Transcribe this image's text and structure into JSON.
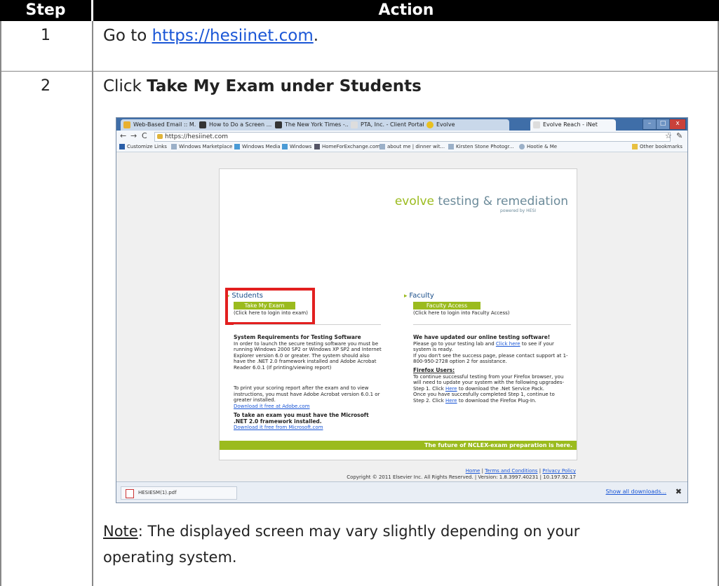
{
  "table": {
    "header_step": "Step",
    "header_action": "Action",
    "rows": [
      {
        "step": "1",
        "text_prefix": "Go to ",
        "link": "https://hesiinet.com",
        "text_suffix": "."
      },
      {
        "step": "2",
        "text_prefix": "Click ",
        "bold": "Take My Exam under Students"
      }
    ],
    "note_label": "Note",
    "note_text": ":  The displayed screen may vary slightly depending on your operating system."
  },
  "browser": {
    "tabs": [
      "Web-Based Email :: M...",
      "How to Do a Screen ...",
      "The New York Times -...",
      "PTA, Inc. - Client Portal",
      "Evolve",
      "Evolve Reach - iNet"
    ],
    "url": "https://hesiinet.com",
    "bookmarks": [
      "Customize Links",
      "Windows Marketplace",
      "Windows Media",
      "Windows",
      "HomeForExchange.com",
      "about me | dinner wit...",
      "Kirsten Stone Photogr...",
      "Hootie & Me",
      "Other bookmarks"
    ],
    "download_file": "HESIESM(1).pdf",
    "show_all_downloads": "Show all downloads...",
    "tab_colors": [
      "#e8b030",
      "#333333",
      "#333333",
      "#dddddd",
      "#e8c020",
      "#dddddd"
    ]
  },
  "page": {
    "logo_main": "volve",
    "logo_prefix": "e",
    "logo_rest": "testing & remediation",
    "logo_sub": "powered by HESI",
    "students_label": "Students",
    "students_button": "Take My Exam",
    "students_hint": "(Click here to login into exam)",
    "faculty_label": "Faculty",
    "faculty_button": "Faculty Access",
    "faculty_hint": "(Click here to login into Faculty Access)",
    "sysreq_title": "System Requirements for Testing Software",
    "sysreq_body": "In order to launch the secure testing software you must be running Windows 2000 SP2 or Windows XP SP2 and Internet Explorer version 6.0 or greater. The system should also have the .NET 2.0 framework installed and Adobe Acrobat Reader 6.0.1 (If printing/viewing report)",
    "print_body": "To print your scoring report after the exam and to view instructions, you must have Adobe Acrobat version 6.0.1 or greater installed.",
    "adobe_link": "Download it free at Adobe.com",
    "net_title": "To take an exam you must have the Microsoft .NET 2.0 framework installed.",
    "ms_link": "Download it free from Microsoft.com",
    "update_title": "We have updated our online testing software!",
    "update_body_1": "Please go to your testing lab and ",
    "update_link": "Click here",
    "update_body_2": " to see if your system is ready.",
    "update_body_3": "If you don't see the success page, please contact support at 1-800-950-2728 option 2 for assistance.",
    "firefox_title": "Firefox Users:",
    "firefox_body": "To continue successful testing from your Firefox browser, you will need to update your system with the following upgrades-",
    "step1_a": "Step 1. Click ",
    "step1_link": "Here",
    "step1_b": " to download the .Net Service Pack.",
    "step1_c": "Once you have succesfully completed Step 1, continue to",
    "step2_a": "Step 2. Click ",
    "step2_link": "Here",
    "step2_b": " to download the Firefox Plug-In.",
    "footer_text": "The future of NCLEX-exam preparation is here.",
    "home_link": "Home",
    "terms_link": "Terms and Conditions",
    "privacy_link": "Privacy Policy",
    "copyright": "Copyright © 2011 Elsevier Inc. All Rights Reserved. | Version: 1.8.3997.40231 | 10.197.92.17",
    "brand_green": "#9bbb1e",
    "highlight_red": "#e21f1f"
  }
}
